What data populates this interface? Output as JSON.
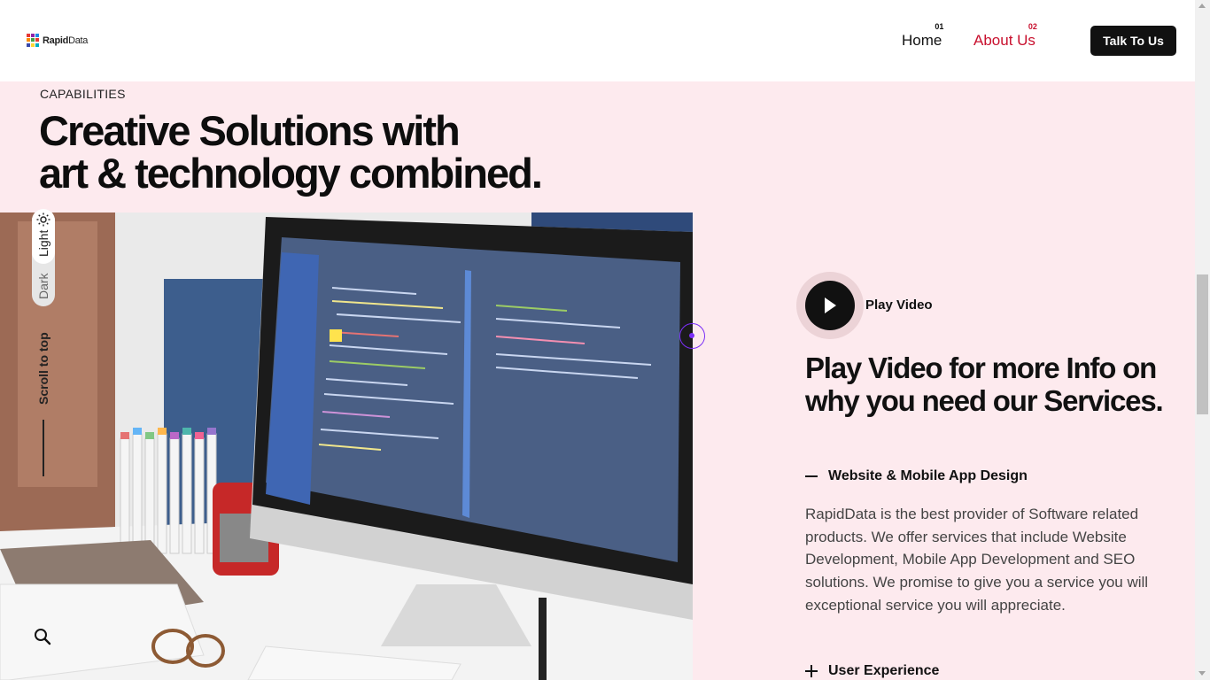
{
  "header": {
    "logo_bold": "Rapid",
    "logo_thin": "Data",
    "nav": [
      {
        "num": "01",
        "label": "Home"
      },
      {
        "num": "02",
        "label": "About Us"
      }
    ],
    "cta_label": "Talk To Us"
  },
  "hero": {
    "eyebrow": "CAPABILITIES",
    "headline_line1": "Creative Solutions with",
    "headline_line2": "art & technology combined."
  },
  "sidebar_tools": {
    "light_label": "Light",
    "dark_label": "Dark",
    "scroll_top_label": "Scroll to top"
  },
  "video": {
    "play_label": "Play Video",
    "heading": "Play Video for more Info on why you need our Services."
  },
  "accordion": [
    {
      "title": "Website & Mobile App Design",
      "expanded": true,
      "body": "RapidData is the best provider of Software related products. We offer services that include Website Development, Mobile App Development and SEO solutions. We promise to give you a service you will exceptional service you will appreciate."
    },
    {
      "title": "User Experience",
      "expanded": false
    }
  ],
  "colors": {
    "accent": "#c8102e",
    "page_bg": "#fdeaee",
    "button_bg": "#111111"
  }
}
